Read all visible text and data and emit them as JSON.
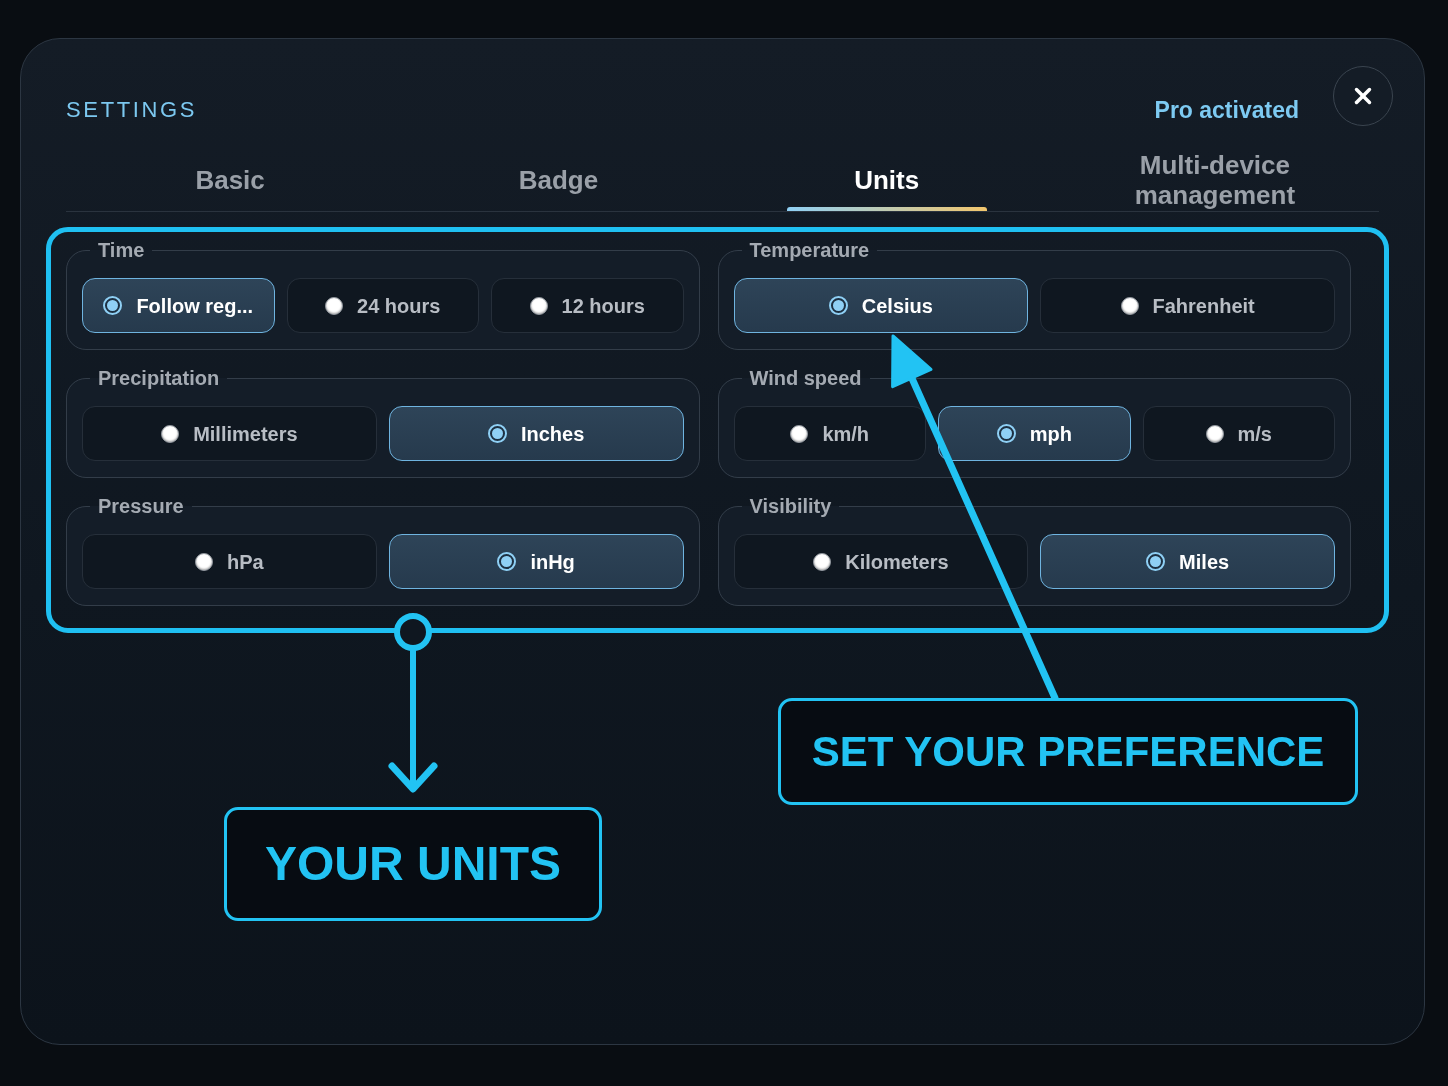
{
  "header": {
    "title": "SETTINGS",
    "status": "Pro activated"
  },
  "tabs": [
    {
      "label": "Basic",
      "selected": false
    },
    {
      "label": "Badge",
      "selected": false
    },
    {
      "label": "Units",
      "selected": true
    },
    {
      "label": "Multi-device management",
      "selected": false
    }
  ],
  "groups": [
    {
      "label": "Time",
      "options": [
        {
          "label": "Follow reg...",
          "selected": true
        },
        {
          "label": "24 hours",
          "selected": false
        },
        {
          "label": "12 hours",
          "selected": false
        }
      ]
    },
    {
      "label": "Temperature",
      "options": [
        {
          "label": "Celsius",
          "selected": true
        },
        {
          "label": "Fahrenheit",
          "selected": false
        }
      ]
    },
    {
      "label": "Precipitation",
      "options": [
        {
          "label": "Millimeters",
          "selected": false
        },
        {
          "label": "Inches",
          "selected": true
        }
      ]
    },
    {
      "label": "Wind speed",
      "options": [
        {
          "label": "km/h",
          "selected": false
        },
        {
          "label": "mph",
          "selected": true
        },
        {
          "label": "m/s",
          "selected": false
        }
      ]
    },
    {
      "label": "Pressure",
      "options": [
        {
          "label": "hPa",
          "selected": false
        },
        {
          "label": "inHg",
          "selected": true
        }
      ]
    },
    {
      "label": "Visibility",
      "options": [
        {
          "label": "Kilometers",
          "selected": false
        },
        {
          "label": "Miles",
          "selected": true
        }
      ]
    }
  ],
  "callouts": [
    {
      "kind": "diagonal",
      "text": "SET YOUR PREFERENCE"
    },
    {
      "kind": "down",
      "text": "YOUR UNITS"
    }
  ]
}
